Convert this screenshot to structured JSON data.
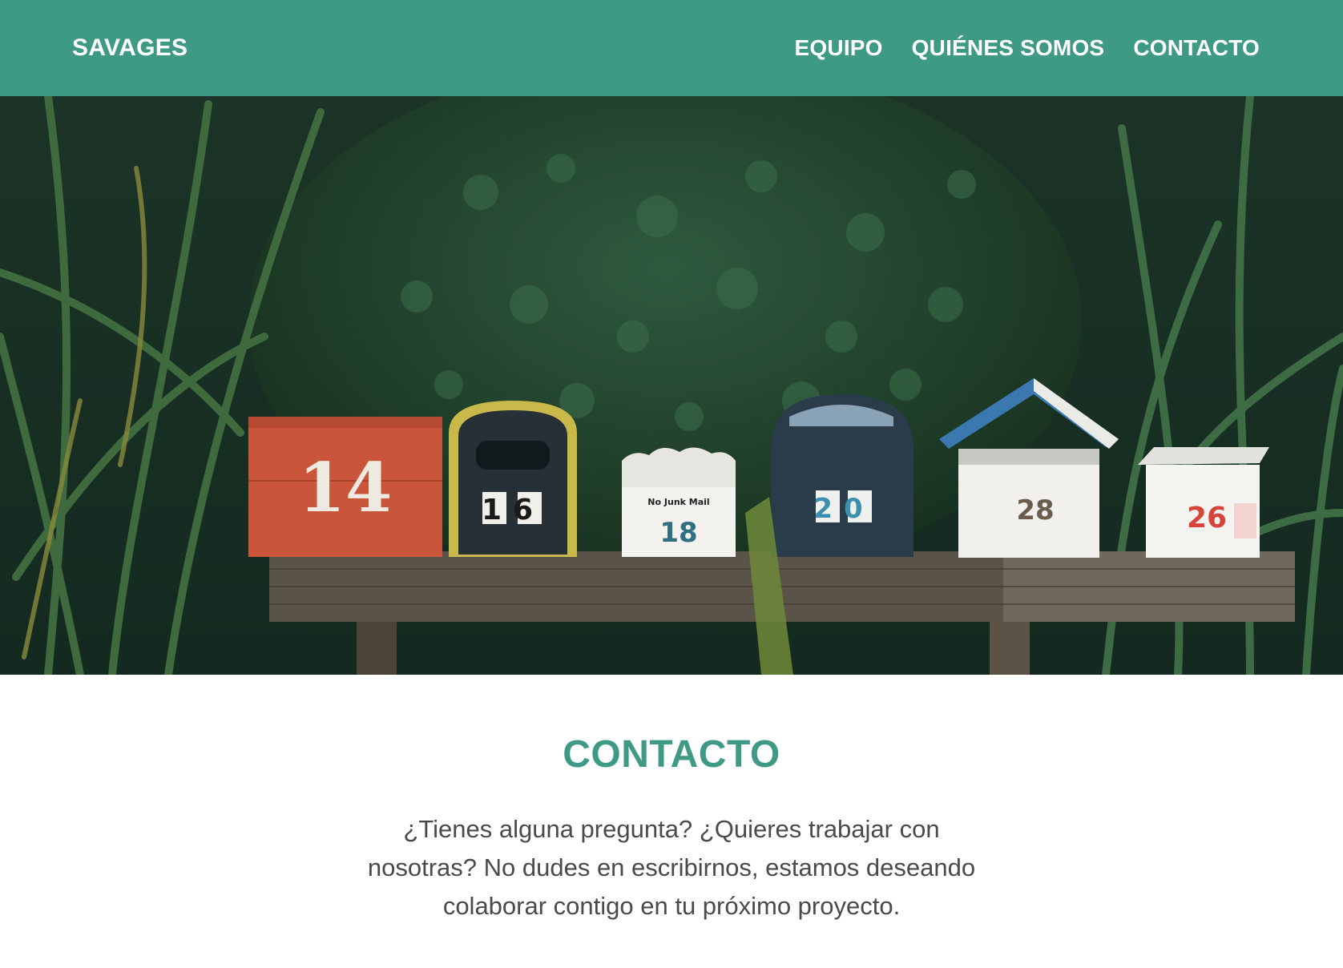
{
  "header": {
    "logo": "SAVAGES",
    "nav": [
      {
        "label": "EQUIPO"
      },
      {
        "label": "QUIÉNES SOMOS"
      },
      {
        "label": "CONTACTO"
      }
    ]
  },
  "hero": {
    "mailboxes": [
      {
        "number": "14"
      },
      {
        "number": "16"
      },
      {
        "number": "18",
        "sign": "No Junk Mail"
      },
      {
        "number": "20"
      },
      {
        "number": "28"
      },
      {
        "number": "26"
      }
    ]
  },
  "contact": {
    "title": "CONTACTO",
    "text": "¿Tienes alguna pregunta? ¿Quieres trabajar con nosotras? No dudes en escribirnos, estamos deseando colaborar contigo en tu próximo proyecto."
  },
  "colors": {
    "accent": "#3f9a85",
    "text": "#4a4a4a"
  }
}
